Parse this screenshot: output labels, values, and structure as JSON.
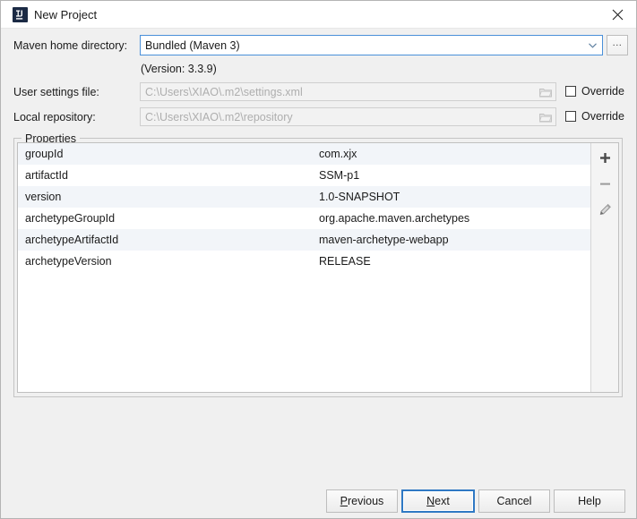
{
  "window": {
    "title": "New Project",
    "app_icon": "intellij-idea-icon",
    "close_icon": "close-icon"
  },
  "form": {
    "maven_home": {
      "label": "Maven home directory:",
      "value": "Bundled (Maven 3)",
      "dropdown_icon": "chevron-down-icon",
      "browse_label": "...",
      "version_note": "(Version: 3.3.9)"
    },
    "user_settings": {
      "label": "User settings file:",
      "value": "C:\\Users\\XIAO\\.m2\\settings.xml",
      "folder_icon": "folder-icon",
      "override_label": "Override",
      "override_checked": false
    },
    "local_repository": {
      "label": "Local repository:",
      "value": "C:\\Users\\XIAO\\.m2\\repository",
      "folder_icon": "folder-icon",
      "override_label": "Override",
      "override_checked": false
    }
  },
  "properties": {
    "group_title": "Properties",
    "rows": [
      {
        "key": "groupId",
        "value": "com.xjx"
      },
      {
        "key": "artifactId",
        "value": "SSM-p1"
      },
      {
        "key": "version",
        "value": "1.0-SNAPSHOT"
      },
      {
        "key": "archetypeGroupId",
        "value": "org.apache.maven.archetypes"
      },
      {
        "key": "archetypeArtifactId",
        "value": "maven-archetype-webapp"
      },
      {
        "key": "archetypeVersion",
        "value": "RELEASE"
      }
    ],
    "toolbar": {
      "add_icon": "plus-icon",
      "remove_icon": "minus-icon",
      "edit_icon": "pencil-icon"
    }
  },
  "footer": {
    "previous": {
      "pre": "P",
      "mnemonic": "",
      "post": "revious",
      "label": "Previous"
    },
    "next": {
      "pre": "",
      "mnemonic": "N",
      "post": "ext",
      "label": "Next",
      "focused": true
    },
    "cancel": {
      "label": "Cancel"
    },
    "help": {
      "label": "Help"
    }
  },
  "colors": {
    "focus_blue": "#2f79c4",
    "combo_border": "#4a90d9",
    "row_stripe": "#f2f5f9",
    "dialog_bg": "#f0f0f0"
  }
}
